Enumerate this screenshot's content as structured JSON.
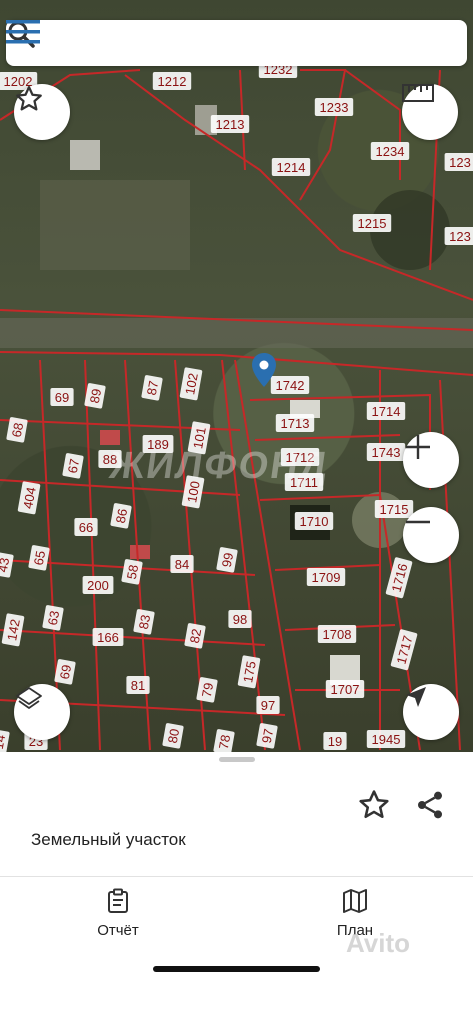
{
  "map": {
    "watermark": "ЖИЛФОНД",
    "parcels": [
      "1202",
      "1212",
      "1232",
      "1233",
      "1213",
      "1214",
      "1234",
      "123",
      "1215",
      "123",
      "1742",
      "1714",
      "1713",
      "1743",
      "1712",
      "1711",
      "1715",
      "1710",
      "1716",
      "1709",
      "1708",
      "1717",
      "1707",
      "1945",
      "19",
      "87",
      "102",
      "69",
      "89",
      "68",
      "189",
      "101",
      "67",
      "88",
      "404",
      "100",
      "66",
      "86",
      "65",
      "84",
      "58",
      "99",
      "200",
      "43",
      "63",
      "98",
      "83",
      "142",
      "166",
      "82",
      "69",
      "81",
      "175",
      "79",
      "97",
      "97",
      "80",
      "23",
      "78",
      "14"
    ]
  },
  "parcel": {
    "title": "Земельный участок"
  },
  "tabs": [
    {
      "label": "Отчёт",
      "icon": "clipboard-icon"
    },
    {
      "label": "План",
      "icon": "map-icon"
    }
  ],
  "overlay": {
    "avito": "Avito"
  },
  "colors": {
    "boundary": "#c62828",
    "accent": "#2a6fb0"
  }
}
